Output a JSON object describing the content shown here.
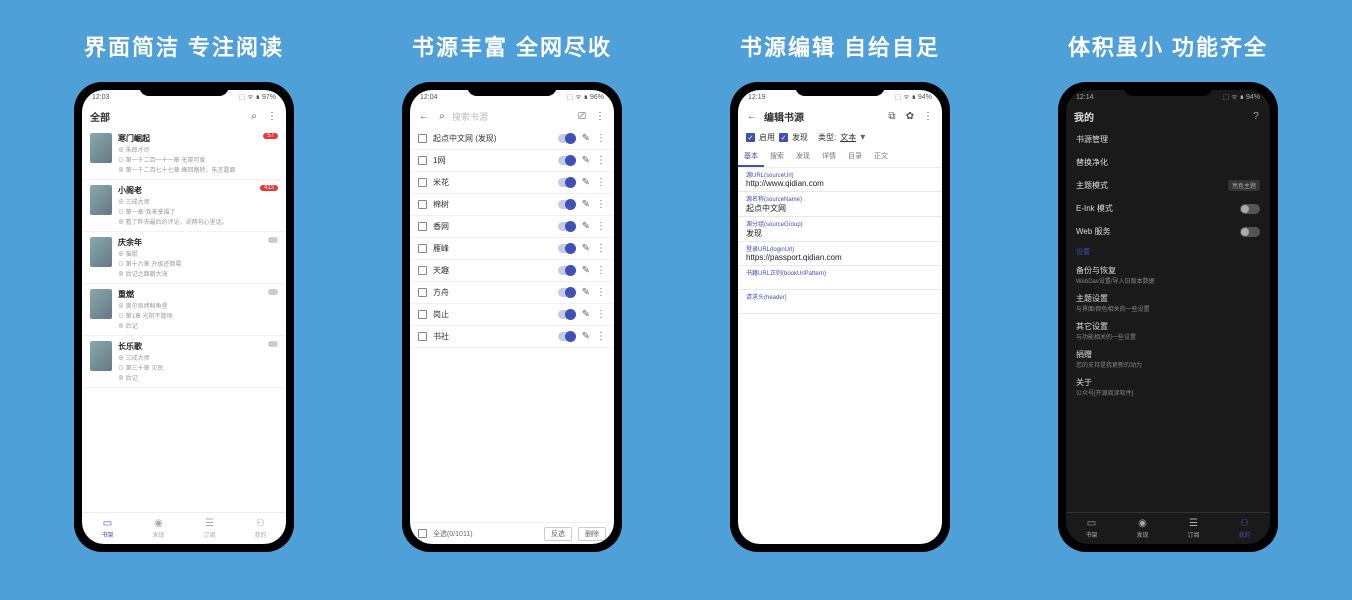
{
  "headlines": [
    "界面简洁  专注阅读",
    "书源丰富  全网尽收",
    "书源编辑  自给自足",
    "体积虽小  功能齐全"
  ],
  "status": {
    "s1": {
      "time": "12:03",
      "right": "⬚ ᯤ ∎ 97%"
    },
    "s2": {
      "time": "12:04",
      "right": "⬚ ᯤ ∎ 96%"
    },
    "s3": {
      "time": "12:19",
      "right": "⬚ ᯤ ∎ 94%"
    },
    "s4": {
      "time": "12:14",
      "right": "⬚ ᯤ ∎ 94%"
    }
  },
  "screen1": {
    "tab": "全部",
    "books": [
      {
        "title": "寒门崛起",
        "author": "⊕ 朱郎才尽",
        "line1": "⊙ 第一千二百一十一章 无辜可爱",
        "line2": "⊗ 第一千二百七十七章 峰回路转，朱言露面",
        "badge": "57"
      },
      {
        "title": "小阁老",
        "author": "⊕ 三戒大师",
        "line1": "⊙ 第一章 我来享福了",
        "line2": "⊗ 看了昨天最后的评论，说两句心里话。",
        "badge": "413"
      },
      {
        "title": "庆余年",
        "author": "⊕ 猫腻",
        "line1": "⊙ 第十六章 升级还倒霉",
        "line2": "⊗ 后记之面朝大海",
        "badge": ""
      },
      {
        "title": "重燃",
        "author": "⊕ 奥尔良烤鲟鱼堡",
        "line1": "⊙ 第1章 光阴不散场",
        "line2": "⊗ 后记",
        "badge": ""
      },
      {
        "title": "长乐歌",
        "author": "⊕ 三戒大师",
        "line1": "⊙ 第三十章 灾民",
        "line2": "⊗ 后记",
        "badge": ""
      }
    ],
    "nav": [
      "书架",
      "发现",
      "订阅",
      "我的"
    ]
  },
  "screen2": {
    "search_ph": "搜索书源",
    "sources": [
      "起点中文网 (发现)",
      "1网",
      "米花",
      "棉树",
      "香网",
      "雁峰",
      "天趣",
      "方舟",
      "岗止",
      "书社"
    ],
    "selectall": "全选(0/1011)",
    "btn1": "反选",
    "btn2": "删除"
  },
  "screen3": {
    "title": "编辑书源",
    "checks": [
      "启用",
      "发现"
    ],
    "typelabel": "类型:",
    "typeval": "文本",
    "tabs": [
      "基本",
      "搜索",
      "发现",
      "详情",
      "目录",
      "正文"
    ],
    "fields": [
      {
        "label": "源URL(sourceUrl)",
        "val": "http://www.qidian.com"
      },
      {
        "label": "源名称(sourceName)",
        "val": "起点中文网"
      },
      {
        "label": "源分组(sourceGroup)",
        "val": "发现"
      },
      {
        "label": "登录URL(loginUrl)",
        "val": "https://passport.qidian.com"
      },
      {
        "label": "书籍URL正则(bookUrlPattern)",
        "val": ""
      },
      {
        "label": "请求头(header)",
        "val": ""
      }
    ]
  },
  "screen4": {
    "title": "我的",
    "rows": [
      "书源管理",
      "替换净化"
    ],
    "theme": {
      "label": "主题模式",
      "chip": "亮色主题"
    },
    "toggles": [
      {
        "label": "E-Ink 模式"
      },
      {
        "label": "Web 服务"
      }
    ],
    "section": "设置",
    "items": [
      {
        "t": "备份与恢复",
        "s": "WebDav设置/导入旧版本数据"
      },
      {
        "t": "主题设置",
        "s": "与界面/颜色相关的一些设置"
      },
      {
        "t": "其它设置",
        "s": "与功能相关的一些设置"
      },
      {
        "t": "捐赠",
        "s": "您的支持是我更新的动力"
      },
      {
        "t": "关于",
        "s": "公众号[开源阅读软件]"
      }
    ],
    "nav": [
      "书架",
      "发现",
      "订阅",
      "我的"
    ]
  }
}
